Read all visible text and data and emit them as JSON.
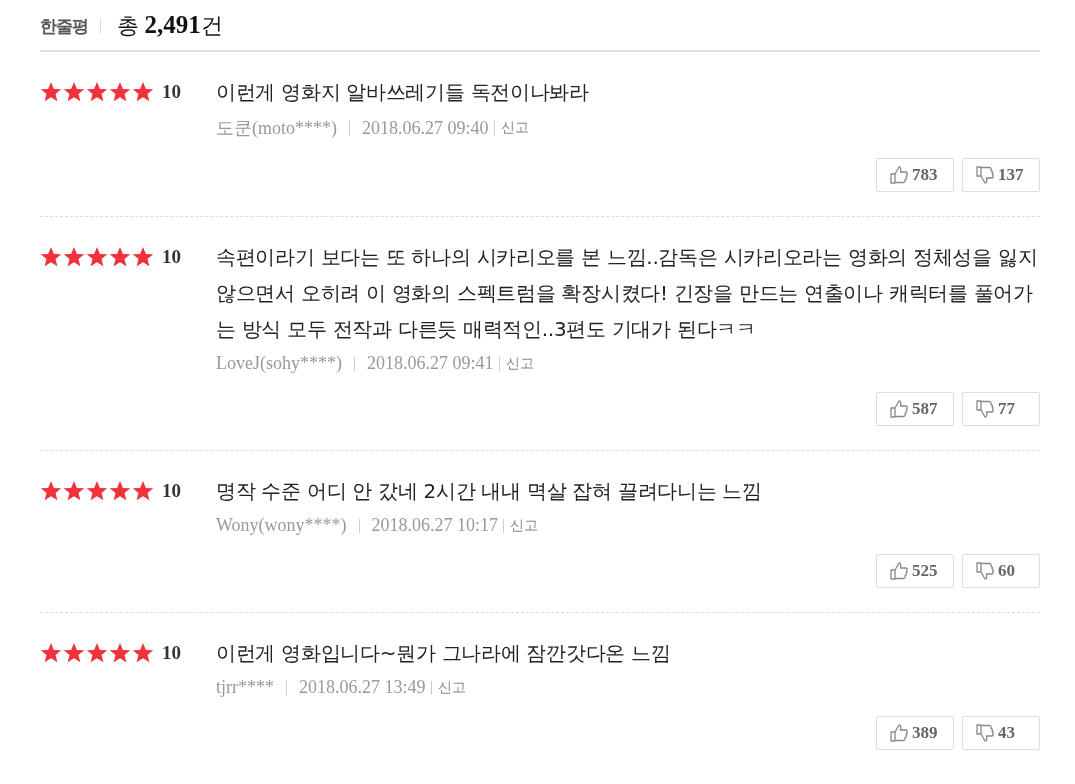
{
  "header": {
    "title": "한줄평",
    "total": "총 **2,491**건"
  },
  "reviews": [
    {
      "stars": 5,
      "score": "10",
      "text": "이런게 영화지 알바쓰레기들 독전이나봐라",
      "author": "도쿤(moto****)",
      "date": "2018.06.27 09:40",
      "report": "신고",
      "likes": "783",
      "dislikes": "137"
    },
    {
      "stars": 5,
      "score": "10",
      "text": "속편이라기 보다는 또 하나의 시카리오를 본 느낌..감독은 시카리오라는 영화의 정체성을 잃지 않으면서 오히려 이 영화의 스펙트럼을 확장시켰다! 긴장을 만드는 연출이나 캐릭터를 풀어가는 방식 모두 전작과 다른듯 매력적인..3편도 기대가 된다ㅋㅋ",
      "author": "LoveJ(sohy****)",
      "date": "2018.06.27 09:41",
      "report": "신고",
      "likes": "587",
      "dislikes": "77"
    },
    {
      "stars": 5,
      "score": "10",
      "text": "명작 수준 어디 안 갔네 2시간 내내 멱살 잡혀 끌려다니는 느낌",
      "author": "Wony(wony****)",
      "date": "2018.06.27 10:17",
      "report": "신고",
      "likes": "525",
      "dislikes": "60"
    },
    {
      "stars": 5,
      "score": "10",
      "text": "이런게 영화입니다~뭔가 그나라에 잠깐갓다온 느낌",
      "author": "tjrr****",
      "date": "2018.06.27 13:49",
      "report": "신고",
      "likes": "389",
      "dislikes": "43"
    }
  ]
}
